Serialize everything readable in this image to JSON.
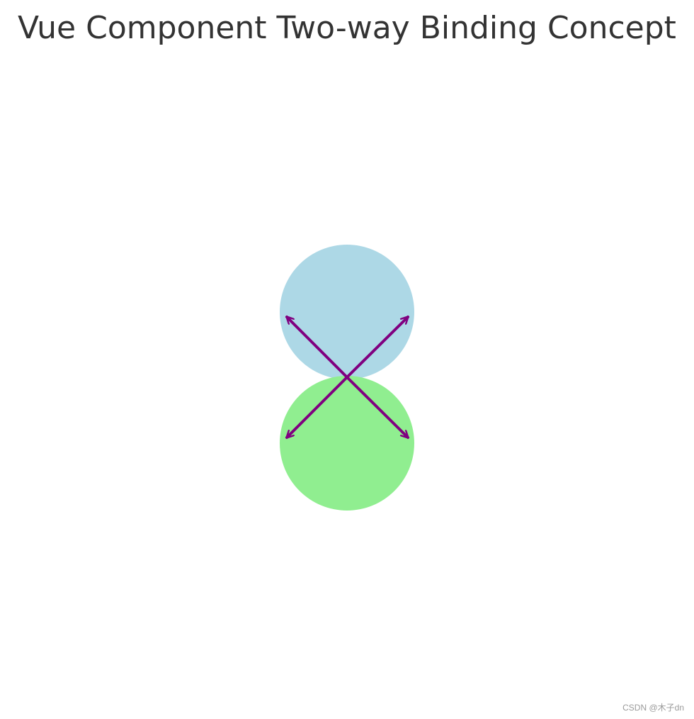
{
  "title": "Vue Component Two-way Binding Concept",
  "watermark": "CSDN @木子dn",
  "diagram": {
    "nodes": [
      {
        "name": "upper-circle",
        "color": "#add8e6"
      },
      {
        "name": "lower-circle",
        "color": "#90ee90"
      }
    ],
    "arrow_color": "#800080",
    "arrows": [
      {
        "name": "arrow-up-left",
        "direction": "up-left"
      },
      {
        "name": "arrow-up-right",
        "direction": "up-right"
      },
      {
        "name": "arrow-down-left",
        "direction": "down-left"
      },
      {
        "name": "arrow-down-right",
        "direction": "down-right"
      }
    ]
  }
}
